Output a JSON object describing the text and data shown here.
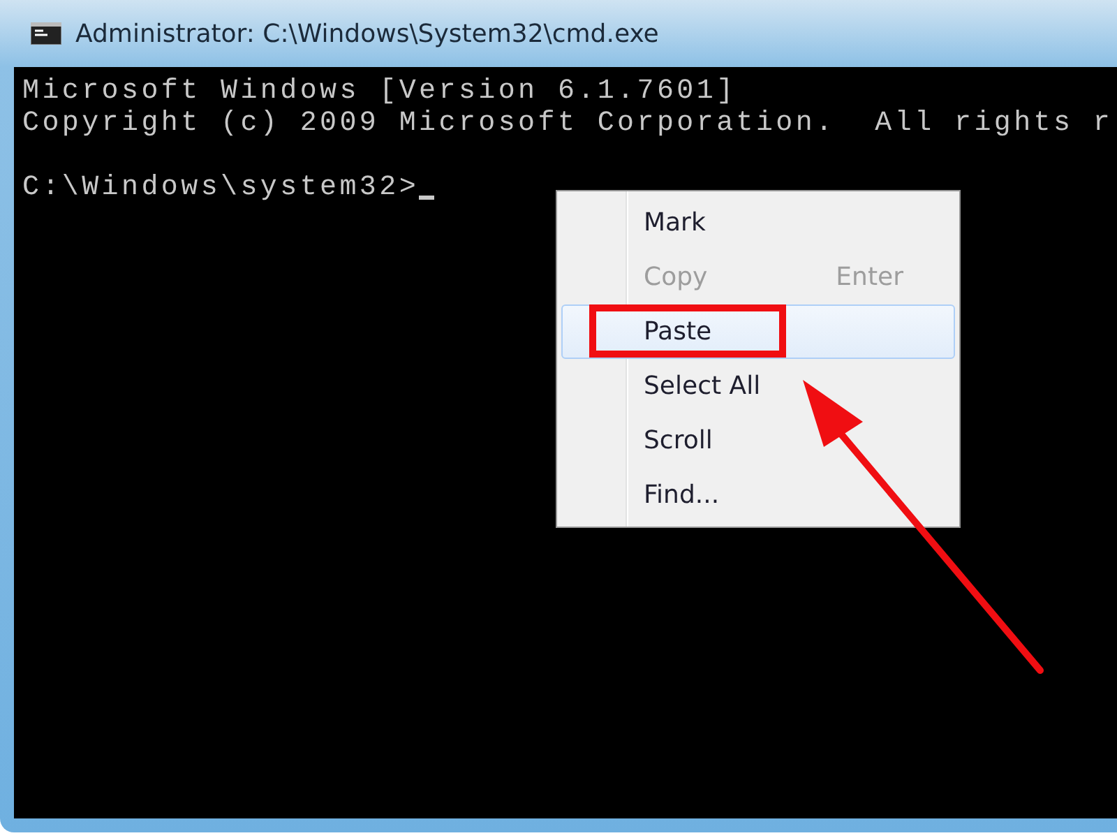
{
  "window": {
    "title": "Administrator: C:\\Windows\\System32\\cmd.exe"
  },
  "console": {
    "output": [
      "Microsoft Windows [Version 6.1.7601]",
      "Copyright (c) 2009 Microsoft Corporation.  All rights r"
    ],
    "prompt": "C:\\Windows\\system32>"
  },
  "context_menu": {
    "items": [
      {
        "label": "Mark",
        "disabled": false,
        "selected": false
      },
      {
        "label": "Copy",
        "shortcut": "Enter",
        "disabled": true,
        "selected": false
      },
      {
        "label": "Paste",
        "disabled": false,
        "selected": true
      },
      {
        "label": "Select All",
        "disabled": false,
        "selected": false
      },
      {
        "label": "Scroll",
        "disabled": false,
        "selected": false
      },
      {
        "label": "Find...",
        "disabled": false,
        "selected": false
      }
    ]
  }
}
